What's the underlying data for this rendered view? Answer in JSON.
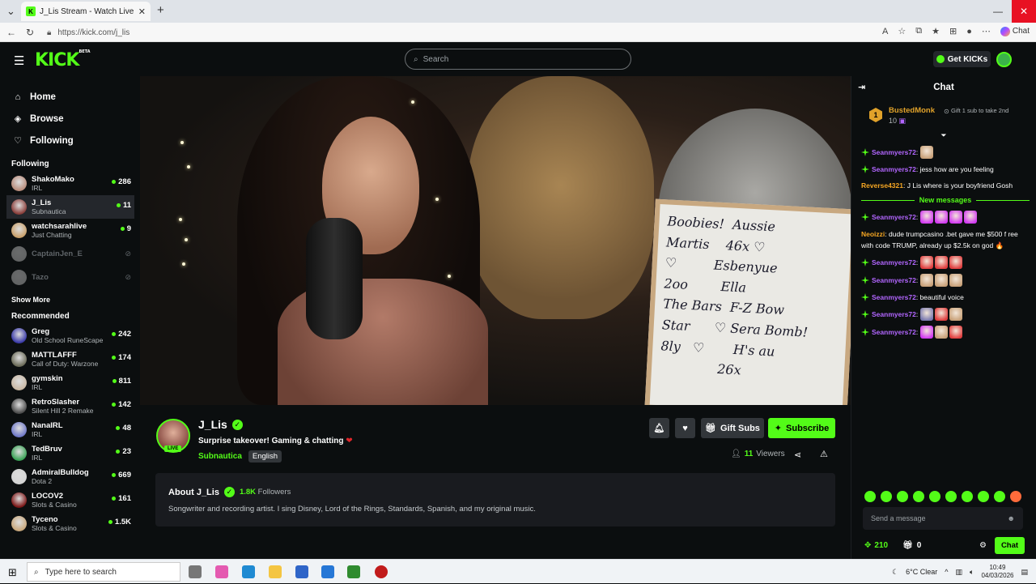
{
  "browser": {
    "tab_title": "J_Lis Stream - Watch Live on K",
    "url": "https://kick.com/j_lis",
    "copilot_label": "Chat"
  },
  "topnav": {
    "logo": "KICK",
    "logo_sup": "BETA",
    "search_placeholder": "Search",
    "get_kicks_label": "Get KICKs"
  },
  "sidebar": {
    "main": [
      {
        "label": "Home",
        "icon": "home-icon"
      },
      {
        "label": "Browse",
        "icon": "compass-icon"
      },
      {
        "label": "Following",
        "icon": "heart-icon"
      }
    ],
    "following_title": "Following",
    "following": [
      {
        "name": "ShakoMako",
        "category": "IRL",
        "viewers": "286",
        "color": "#b98d7c"
      },
      {
        "name": "J_Lis",
        "category": "Subnautica",
        "viewers": "11",
        "color": "#8a3e3a"
      },
      {
        "name": "watchsarahlive",
        "category": "Just Chatting",
        "viewers": "9",
        "color": "#c9a06a"
      },
      {
        "name": "CaptainJen_E",
        "category": "",
        "viewers": "",
        "color": "#cccccc"
      },
      {
        "name": "Tazo",
        "category": "",
        "viewers": "",
        "color": "#cccccc"
      }
    ],
    "show_more": "Show More",
    "recommended_title": "Recommended",
    "recommended": [
      {
        "name": "Greg",
        "category": "Old School RuneScape",
        "viewers": "242",
        "color": "#3a3aa8"
      },
      {
        "name": "MATTLAFFF",
        "category": "Call of Duty: Warzone",
        "viewers": "174",
        "color": "#6b6b58"
      },
      {
        "name": "gymskin",
        "category": "IRL",
        "viewers": "811",
        "color": "#c9b8a4"
      },
      {
        "name": "RetroSlasher",
        "category": "Silent Hill 2 Remake",
        "viewers": "142",
        "color": "#4b4b4b"
      },
      {
        "name": "NanaIRL",
        "category": "IRL",
        "viewers": "48",
        "color": "#6f78c8"
      },
      {
        "name": "TedBruv",
        "category": "IRL",
        "viewers": "23",
        "color": "#3aa356"
      },
      {
        "name": "AdmiralBulldog",
        "category": "Dota 2",
        "viewers": "669",
        "color": "#d4d4d4"
      },
      {
        "name": "LOCOV2",
        "category": "Slots & Casino",
        "viewers": "161",
        "color": "#7b1616"
      },
      {
        "name": "Tyceno",
        "category": "Slots & Casino",
        "viewers": "1.5K",
        "color": "#c9a87c"
      }
    ]
  },
  "stream": {
    "name": "J_Lis",
    "title": "Surprise takeover! Gaming & chatting",
    "category": "Subnautica",
    "language": "English",
    "live_label": "LIVE",
    "viewers_count": "11",
    "viewers_label": "Viewers",
    "gift_subs_label": "Gift Subs",
    "subscribe_label": "Subscribe",
    "whiteboard_text": "Boobies!  Aussie\nMartis    46x ♡\n♡         Esbenyue\n2oo        Ella\nThe Bars  F-Z Bow\nStar      ♡ Sera Bomb!\n8ly   ♡       H's au\n              26x"
  },
  "about": {
    "title": "About J_Lis",
    "followers_count": "1.8K",
    "followers_label": "Followers",
    "bio": "Songwriter and recording artist. I sing Disney, Lord of the Rings, Standards, Spanish, and my original music."
  },
  "chat": {
    "title": "Chat",
    "pinned_gifter": {
      "rank": "1",
      "name": "BustedMonk",
      "count": "10",
      "hint": "Gift 1 sub to take 2nd"
    },
    "new_messages_label": "New messages",
    "messages": [
      {
        "user": "Seanmyers72",
        "color": "#b266ff",
        "badge": true,
        "text": "",
        "emotes": [
          "#c9a27a"
        ]
      },
      {
        "user": "Seanmyers72",
        "color": "#b266ff",
        "badge": true,
        "text": "jess how are you feeling",
        "emotes": []
      },
      {
        "user": "Reverse4321",
        "color": "#f5a623",
        "badge": false,
        "text": "J Lis where is your boyfriend Gosh",
        "emotes": []
      }
    ],
    "messages_new": [
      {
        "user": "Seanmyers72",
        "color": "#b266ff",
        "badge": true,
        "text": "",
        "emotes": [
          "#d23cf0",
          "#d23cf0",
          "#d23cf0",
          "#d23cf0"
        ]
      },
      {
        "user": "Neoizzi",
        "color": "#f5a623",
        "badge": false,
        "text": "dude trumpcasino .bet gave me $500 f ree with code TRUMP, already up $2.5k on god 🔥",
        "emotes": []
      },
      {
        "user": "Seanmyers72",
        "color": "#b266ff",
        "badge": true,
        "text": "",
        "emotes": [
          "#e04040",
          "#e04040",
          "#e04040"
        ]
      },
      {
        "user": "Seanmyers72",
        "color": "#b266ff",
        "badge": true,
        "text": "",
        "emotes": [
          "#c9a27a",
          "#c9a27a",
          "#c9a27a"
        ]
      },
      {
        "user": "Seanmyers72",
        "color": "#b266ff",
        "badge": true,
        "text": "beautiful voice",
        "emotes": []
      },
      {
        "user": "Seanmyers72",
        "color": "#b266ff",
        "badge": true,
        "text": "",
        "emotes": [
          "#7a7ab0",
          "#e04040",
          "#c9a27a"
        ]
      },
      {
        "user": "Seanmyers72",
        "color": "#b266ff",
        "badge": true,
        "text": "",
        "emotes": [
          "#d23cf0",
          "#c9a27a",
          "#e04040"
        ]
      }
    ],
    "input_placeholder": "Send a message",
    "kicks_count": "210",
    "gifts_count": "0",
    "send_label": "Chat"
  },
  "taskbar": {
    "search_placeholder": "Type here to search",
    "weather": "6°C  Clear",
    "time": "10:49",
    "date": "04/03/2026"
  },
  "colors": {
    "accent": "#53fc18",
    "background": "#0b0e0f",
    "panel": "#191b1f"
  }
}
